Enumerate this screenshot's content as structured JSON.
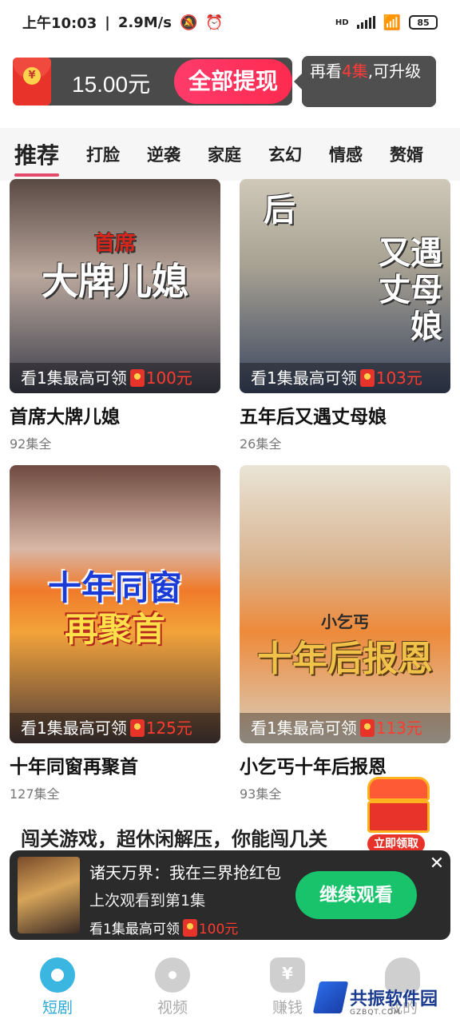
{
  "status_bar": {
    "time": "上午10:03",
    "speed": "2.9M/s",
    "network": "HD",
    "battery": "85",
    "icons": [
      "mute-icon",
      "alarm-icon",
      "signal-icon",
      "wifi-icon",
      "battery-icon"
    ]
  },
  "reward_banner": {
    "balance": "15.00元",
    "withdraw_label": "全部提现",
    "tip_prefix": "再看",
    "tip_highlight": "4集",
    "tip_suffix": ",可升级",
    "coin_symbol": "¥"
  },
  "tabs": [
    {
      "label": "推荐",
      "active": true
    },
    {
      "label": "打脸"
    },
    {
      "label": "逆袭"
    },
    {
      "label": "家庭"
    },
    {
      "label": "玄幻"
    },
    {
      "label": "情感"
    },
    {
      "label": "赘婿"
    }
  ],
  "cards": [
    {
      "poster_title_line1": "首席",
      "poster_title_line2": "大牌儿媳",
      "reward_prefix": "看1集最高可领",
      "reward_amount": "100元",
      "title": "首席大牌儿媳",
      "episodes": "92集全"
    },
    {
      "poster_title_line1": "后",
      "poster_title_line2": "又遇丈母娘",
      "reward_prefix": "看1集最高可领",
      "reward_amount": "103元",
      "title": "五年后又遇丈母娘",
      "episodes": "26集全"
    },
    {
      "poster_title_line1": "十年同窗",
      "poster_title_line2": "再聚首",
      "reward_prefix": "看1集最高可领",
      "reward_amount": "125元",
      "title": "十年同窗再聚首",
      "episodes": "127集全"
    },
    {
      "poster_title_line1": "小乞丐",
      "poster_title_line2": "十年后报恩",
      "reward_prefix": "看1集最高可领",
      "reward_amount": "113元",
      "title": "小乞丐十年后报恩",
      "episodes": "93集全"
    }
  ],
  "game_banner": "闯关游戏，超休闲解压，你能闯几关",
  "chest_label": "立即领取",
  "continue_watching": {
    "title": "诸天万界：我在三界抢红包",
    "progress": "上次观看到第1集",
    "reward_prefix": "看1集最高可领",
    "reward_amount": "100元",
    "button": "继续观看",
    "close": "✕"
  },
  "bottom_nav": [
    {
      "label": "短剧",
      "icon": "film-reel-icon",
      "active": true
    },
    {
      "label": "视频",
      "icon": "video-disc-icon"
    },
    {
      "label": "赚钱",
      "icon": "money-bag-icon"
    },
    {
      "label": "我的",
      "icon": "user-icon"
    }
  ],
  "watermark": {
    "text": "共振软件园",
    "sub": "GZBQT.COM"
  },
  "colors": {
    "accent_pink": "#ff2a50",
    "green": "#19c36b",
    "nav_active": "#2ba9d6",
    "reward_red": "#ff3b30"
  }
}
